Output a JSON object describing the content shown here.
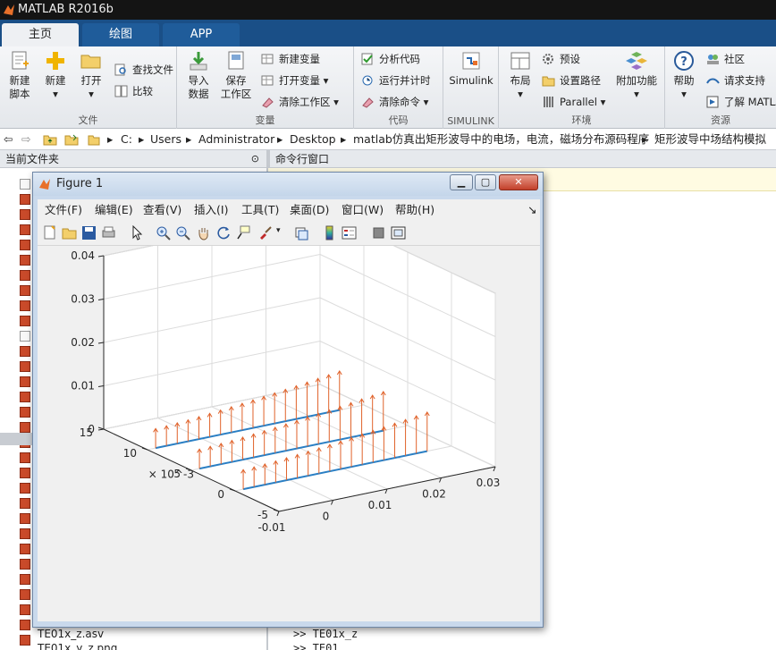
{
  "app": {
    "title": "MATLAB R2016b"
  },
  "tabs": [
    {
      "label": "主页"
    },
    {
      "label": "绘图"
    },
    {
      "label": "APP"
    }
  ],
  "ribbon": {
    "file": {
      "label": "文件",
      "new_script": "新建\n脚本",
      "new": "新建",
      "open": "打开",
      "find_files": "查找文件",
      "compare": "比较"
    },
    "variable": {
      "label": "变量",
      "import": "导入\n数据",
      "save_ws": "保存\n工作区",
      "new_var": "新建变量",
      "open_var": "打开变量",
      "clear_ws": "清除工作区"
    },
    "code": {
      "label": "代码",
      "analyze": "分析代码",
      "run_time": "运行并计时",
      "clear_cmd": "清除命令"
    },
    "simulink": {
      "label": "SIMULINK",
      "simulink": "Simulink"
    },
    "env": {
      "label": "环境",
      "layout": "布局",
      "prefs": "预设",
      "set_path": "设置路径",
      "parallel": "Parallel",
      "addons": "附加功能"
    },
    "resources": {
      "label": "资源",
      "help": "帮助",
      "community": "社区",
      "support": "请求支持",
      "learn": "了解 MATLAB"
    }
  },
  "address": {
    "segments": [
      "C:",
      "Users",
      "Administrator",
      "Desktop",
      "matlab仿真出矩形波导中的电场，电流，磁场分布源码程序",
      "矩形波导中场结构模拟"
    ]
  },
  "left_panel": {
    "title": "当前文件夹",
    "files": [
      "TE01x_z.asv",
      "TE01x_y_z.png"
    ]
  },
  "right_panel": {
    "title": "命令行窗口",
    "lines": [
      ">> TE01x_z",
      ">> TE01"
    ]
  },
  "figure": {
    "title": "Figure 1",
    "menus": [
      "文件(F)",
      "编辑(E)",
      "查看(V)",
      "插入(I)",
      "工具(T)",
      "桌面(D)",
      "窗口(W)",
      "帮助(H)"
    ],
    "toolbar_icons": [
      "new-figure-icon",
      "open-file-icon",
      "save-icon",
      "print-icon",
      "pointer-icon",
      "zoom-in-icon",
      "zoom-out-icon",
      "pan-icon",
      "rotate-icon",
      "data-cursor-icon",
      "brush-icon",
      "link-plot-icon",
      "colorbar-icon",
      "legend-icon",
      "hide-tools-icon",
      "show-tools-icon"
    ]
  },
  "chart_data": {
    "type": "quiver3",
    "xticks": [
      "-0.01",
      "0",
      "0.01",
      "0.02",
      "0.03"
    ],
    "yticks": [
      "-5",
      "0",
      "5",
      "10",
      "15"
    ],
    "y_exponent": "× 10^-3",
    "zticks": [
      "0",
      "0.01",
      "0.02",
      "0.03",
      "0.04"
    ],
    "xlim": [
      -0.01,
      0.03
    ],
    "ylim": [
      -0.005,
      0.015
    ],
    "zlim": [
      0,
      0.04
    ],
    "grid": true,
    "lines": [
      {
        "y": 0.01
      },
      {
        "y": 0.005
      },
      {
        "y": 0.0
      }
    ],
    "line_x_range": [
      -0.0085,
      0.0255
    ],
    "arrow_count": 18,
    "arrow_color": "#e0622a",
    "line_color": "#2a7fc4"
  }
}
